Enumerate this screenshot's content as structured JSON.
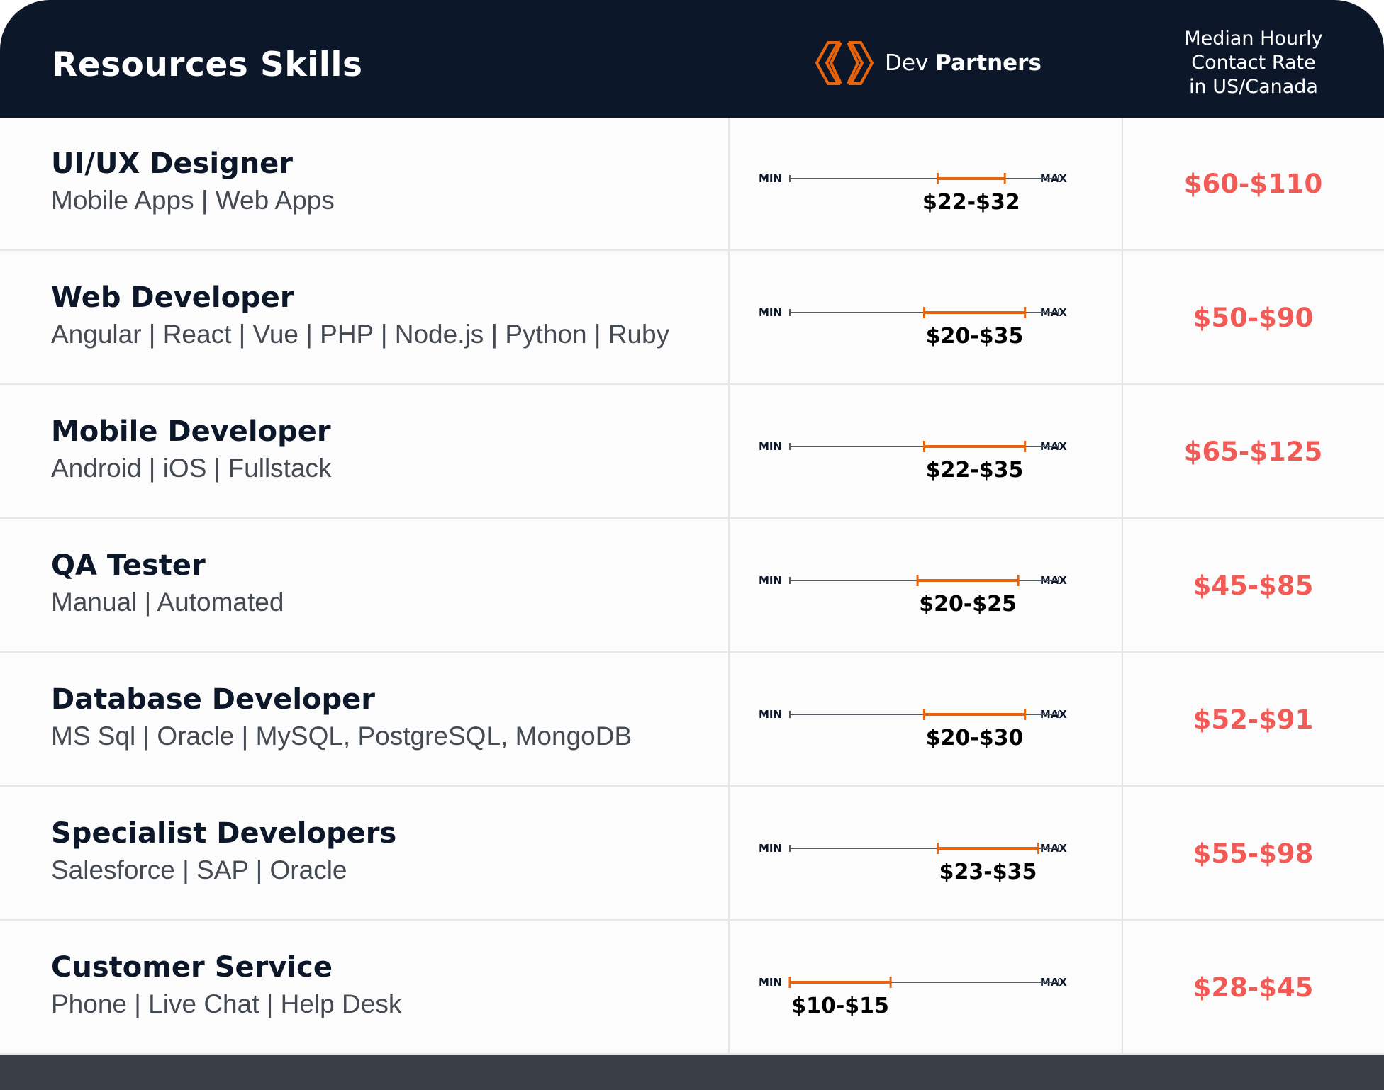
{
  "header": {
    "title": "Resources Skills",
    "logo_text_light": "Dev",
    "logo_text_bold": "Partners",
    "median_lines": [
      "Median Hourly",
      "Contact Rate",
      "in US/Canada"
    ]
  },
  "scale": {
    "min_label": "MIN",
    "max_label": "MAX",
    "axis_min": 0,
    "axis_max": 40
  },
  "colors": {
    "header_bg": "#0c1729",
    "accent_orange": "#e8640c",
    "us_rate_red": "#f15a55",
    "footer": "#3a3f47"
  },
  "rows": [
    {
      "role": "UI/UX Designer",
      "skills": "Mobile Apps | Web Apps",
      "range_label": "$22-$32",
      "low": 22,
      "high": 32,
      "us_rate": "$60-$110"
    },
    {
      "role": "Web Developer",
      "skills": "Angular | React | Vue | PHP | Node.js | Python | Ruby",
      "range_label": "$20-$35",
      "low": 20,
      "high": 35,
      "us_rate": "$50-$90"
    },
    {
      "role": "Mobile Developer",
      "skills": "Android | iOS | Fullstack",
      "range_label": "$22-$35",
      "low": 20,
      "high": 35,
      "us_rate": "$65-$125"
    },
    {
      "role": "QA Tester",
      "skills": "Manual | Automated",
      "range_label": "$20-$25",
      "low": 19,
      "high": 34,
      "us_rate": "$45-$85"
    },
    {
      "role": "Database Developer",
      "skills": "MS Sql | Oracle | MySQL, PostgreSQL, MongoDB",
      "range_label": "$20-$30",
      "low": 20,
      "high": 35,
      "us_rate": "$52-$91"
    },
    {
      "role": "Specialist Developers",
      "skills": "Salesforce | SAP | Oracle",
      "range_label": "$23-$35",
      "low": 22,
      "high": 37,
      "us_rate": "$55-$98"
    },
    {
      "role": "Customer Service",
      "skills": "Phone | Live Chat | Help Desk",
      "range_label": "$10-$15",
      "low": 0,
      "high": 15,
      "us_rate": "$28-$45"
    }
  ]
}
